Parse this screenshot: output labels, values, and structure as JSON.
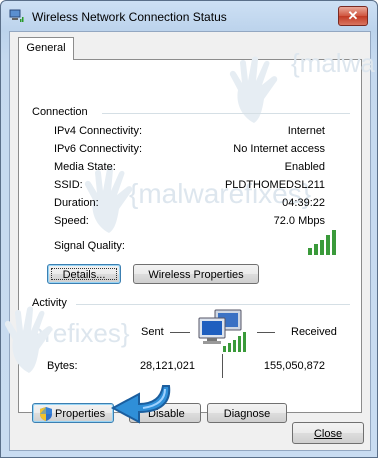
{
  "window": {
    "title": "Wireless Network Connection Status",
    "close_glyph": "✕"
  },
  "tabs": [
    {
      "label": "General"
    }
  ],
  "connection": {
    "header": "Connection",
    "rows": [
      {
        "label": "IPv4 Connectivity:",
        "value": "Internet"
      },
      {
        "label": "IPv6 Connectivity:",
        "value": "No Internet access"
      },
      {
        "label": "Media State:",
        "value": "Enabled"
      },
      {
        "label": "SSID:",
        "value": "PLDTHOMEDSL211"
      },
      {
        "label": "Duration:",
        "value": "04:39:22"
      },
      {
        "label": "Speed:",
        "value": "72.0 Mbps"
      }
    ],
    "signal_label": "Signal Quality:",
    "signal_bars": 5,
    "details_button": "Details...",
    "wireless_properties_button": "Wireless Properties"
  },
  "activity": {
    "header": "Activity",
    "sent_label": "Sent",
    "received_label": "Received",
    "bytes_label": "Bytes:",
    "bytes_sent": "28,121,021",
    "bytes_received": "155,050,872"
  },
  "buttons": {
    "properties": "Properties",
    "disable": "Disable",
    "diagnose": "Diagnose",
    "close": "Close"
  },
  "watermark": {
    "text": "{malwarefixes}",
    "text_short": "{malwa",
    "text_left": "warefixes}"
  },
  "colors": {
    "signal_green": "#3a9a3a",
    "arrow_blue": "#2f8fd8"
  },
  "icons": {
    "network": "network-computers-icon",
    "shield": "uac-shield-icon",
    "wifi": "wireless-network-icon"
  }
}
